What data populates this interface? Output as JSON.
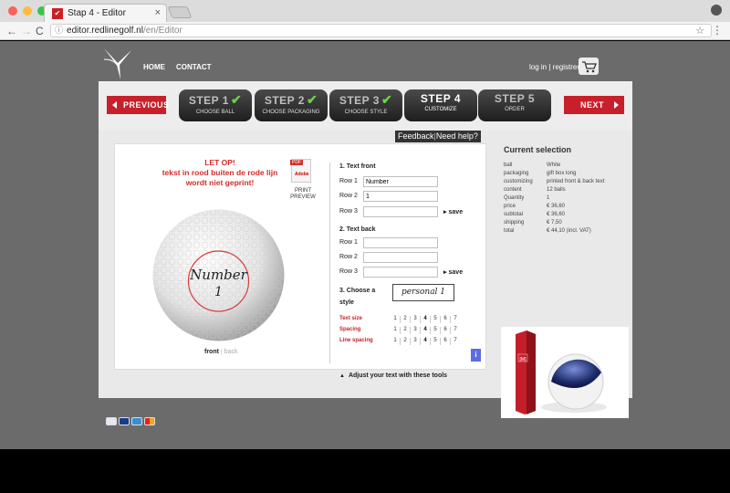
{
  "browser": {
    "tab_title": "Stap 4 - Editor",
    "tab_favicon_icon": "redline-favicon-icon",
    "tab_close": "×",
    "url_host": "editor.redlinegolf.nl",
    "url_path": "/en/Editor",
    "nav_back": "←",
    "nav_forward": "→",
    "nav_reload": "C",
    "star": "☆",
    "menu": "⋮"
  },
  "header": {
    "nav": [
      "HOME",
      "CONTACT"
    ],
    "login_text": "log in | registrer"
  },
  "steps": {
    "previous_label": "PREVIOUS",
    "next_label": "NEXT",
    "items": [
      {
        "number": "STEP 1",
        "label": "CHOOSE BALL",
        "done": true
      },
      {
        "number": "STEP 2",
        "label": "CHOOSE PACKAGING",
        "done": true
      },
      {
        "number": "STEP 3",
        "label": "CHOOSE STYLE",
        "done": true
      },
      {
        "number": "STEP 4",
        "label": "CUSTOMIZE",
        "active": true
      },
      {
        "number": "STEP 5",
        "label": "ORDER"
      }
    ]
  },
  "help": {
    "feedback": "Feedback",
    "need_help": "Need help?"
  },
  "editor": {
    "warning_lines": [
      "LET OP!",
      "tekst in rood buiten de rode lijn",
      "wordt niet geprint!"
    ],
    "pdf_tag": "PDF",
    "pdf_logo": "Adobe",
    "print_preview_lines": [
      "PRINT",
      "PREVIEW"
    ],
    "ball_text_line1": "Number",
    "ball_text_line2": "1",
    "side_front": "front",
    "side_back": "back",
    "front_title": "1. Text front",
    "back_title": "2. Text back",
    "style_title_lines": [
      "3. Choose a",
      "style"
    ],
    "row_labels": [
      "Row 1",
      "Row 2",
      "Row 3"
    ],
    "front_values": [
      "Number",
      "1",
      ""
    ],
    "back_values": [
      "",
      "",
      ""
    ],
    "save_label": "save",
    "style_value": "personal 1",
    "tools": [
      {
        "label": "Text size",
        "selected": 4
      },
      {
        "label": "Spacing",
        "selected": 4
      },
      {
        "label": "Line spacing",
        "selected": 4
      }
    ],
    "tool_options": [
      "1",
      "2",
      "3",
      "4",
      "5",
      "6",
      "7"
    ],
    "info_label": "i",
    "adjust_hint": "Adjust your text with these tools"
  },
  "selection": {
    "title": "Current selection",
    "rows": [
      {
        "key": "ball",
        "value": "White"
      },
      {
        "key": "packaging",
        "value": "gift box long"
      },
      {
        "key": "customizing",
        "value": "printed front & back text"
      },
      {
        "key": "content",
        "value": "12 balls"
      },
      {
        "key": "Quantity",
        "value": "1"
      },
      {
        "key": "price",
        "value": "€ 36,60"
      },
      {
        "key": "subtotal",
        "value": "€ 36,60"
      },
      {
        "key": "shipping",
        "value": "€ 7,50"
      },
      {
        "key": "total",
        "value": "€ 44,10 (incl. VAT)"
      }
    ],
    "box_brand": "[M]"
  },
  "payment_icons": [
    "ideal-icon",
    "visa-icon",
    "amex-icon",
    "mastercard-icon"
  ],
  "colors": {
    "brand_red": "#c8202a",
    "page_bg": "#6b6b6b",
    "step_dark": "#1e1e1e",
    "check_green": "#6dd14a"
  }
}
